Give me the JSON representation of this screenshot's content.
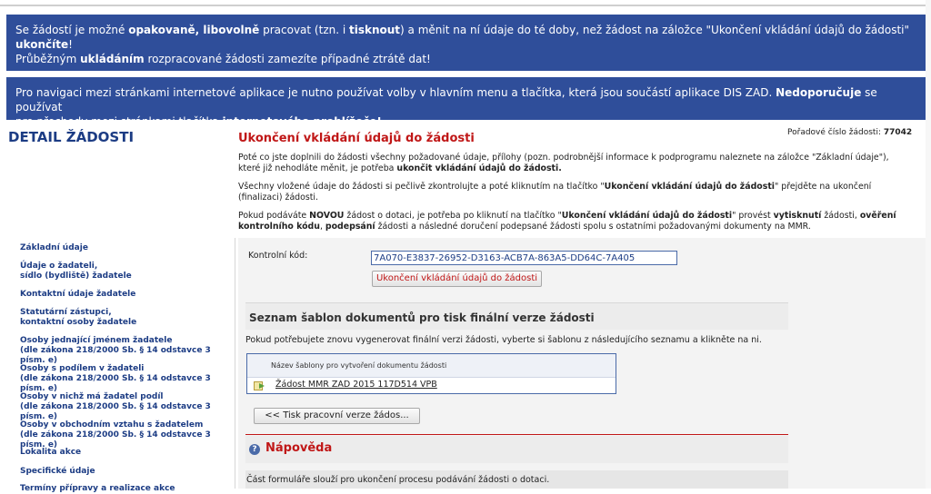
{
  "banner1": {
    "l1a": "Se žádostí je možné ",
    "l1b": "opakovaně, libovolně",
    "l1c": " pracovat (tzn. i ",
    "l1d": "tisknout",
    "l1e": ") a měnit na ní údaje do té doby, než žádost na záložce \"Ukončení vkládání údajů do žádosti\"",
    "l2": "ukončíte",
    "l2b": "!",
    "l3a": "Průběžným ",
    "l3b": "ukládáním",
    "l3c": " rozpracované žádosti zamezíte případné ztrátě dat!"
  },
  "banner2": {
    "a": "Pro navigaci mezi stránkami internetové aplikace je nutno používat volby v hlavním menu a tlačítka, která jsou součástí aplikace DIS ZAD. ",
    "b": "Nedoporučuje",
    "c": " se používat",
    "d": "pro přechody mezi stránkami tlačítka ",
    "e": "internetového prohlížeče!",
    "f": "."
  },
  "sidebar": {
    "title": "DETAIL ŽÁDOSTI",
    "items": [
      {
        "l1": "Základní údaje",
        "l2": ""
      },
      {
        "l1": "Údaje o žadateli,",
        "l2": "sídlo (bydliště) žadatele"
      },
      {
        "l1": "Kontaktní údaje žadatele",
        "l2": ""
      },
      {
        "l1": "Statutární zástupci,",
        "l2": "kontaktní osoby žadatele"
      },
      {
        "l1": "Osoby jednající jménem žadatele",
        "l2": "(dle zákona 218/2000 Sb. § 14 odstavce 3 písm. e)"
      },
      {
        "l1": "Osoby s podílem v žadateli",
        "l2": "(dle zákona 218/2000 Sb. § 14 odstavce 3 písm. e)"
      },
      {
        "l1": "Osoby v nichž má žadatel podíl",
        "l2": "(dle zákona 218/2000 Sb. § 14 odstavce 3 písm. e)"
      },
      {
        "l1": "Osoby v obchodním vztahu s žadatelem",
        "l2": "(dle zákona 218/2000 Sb. § 14 odstavce 3 písm. e)"
      },
      {
        "l1": "Lokalita akce",
        "l2": ""
      },
      {
        "l1": "Specifické údaje",
        "l2": ""
      },
      {
        "l1": "Termíny přípravy a realizace akce",
        "l2": ""
      }
    ]
  },
  "main": {
    "title": "Ukončení vkládání údajů do žádosti",
    "app_no_label": "Pořadové číslo žádosti: ",
    "app_no": "77042",
    "p1a": "Poté co jste doplnili do žádosti všechny požadované údaje, přílohy (pozn. podrobnější informace k podprogramu naleznete na záložce \"Základní údaje\"),",
    "p1b": "které již nehodláte měnit, je potřeba ",
    "p1c": "ukončit vkládání údajů do žádosti.",
    "p2a": "Všechny vložené údaje do žádosti si pečlivě zkontrolujte a poté kliknutím na tlačítko \"",
    "p2b": "Ukončení vkládání údajů do žádosti",
    "p2c": "\" přejděte na ukončení",
    "p2d": "(finalizaci) žádosti.",
    "p3a": "Pokud podáváte ",
    "p3b": "NOVOU",
    "p3c": " žádost o dotaci, je potřeba po kliknutí na tlačítko \"",
    "p3d": "Ukončení vkládání údajů do žádosti",
    "p3e": "\" provést ",
    "p3f": "vytisknutí",
    "p3g": " žádosti, ",
    "p3h": "ověření",
    "p3i": "kontrolního kódu",
    "p3j": ", ",
    "p3k": "podepsání",
    "p3l": " žádosti a následné doručení podepsané žádosti spolu s ostatními požadovanými dokumenty na MMR.",
    "control_label": "Kontrolní kód:",
    "control_code": "7A070-E3837-26952-D3163-ACB7A-863A5-DD64C-7A405",
    "finish_button": "Ukončení vkládání údajů do žádosti",
    "templates_title": "Seznam šablon dokumentů pro tisk finální verze žádosti",
    "templates_note": "Pokud potřebujete znovu vygenerovat finální verzi žádosti, vyberte si šablonu z následujícího seznamu a klikněte na ni.",
    "templates_header": "Název šablony pro vytvoření dokumentu žádosti",
    "template_item": "Žádost MMR ZAD 2015 117D514 VPB",
    "print_button": "<< Tisk pracovní verze žádos...",
    "help_title": "Nápověda",
    "help_icon": "?",
    "help_text": "Část formuláře slouží pro ukončení procesu podávání žádosti o dotaci."
  },
  "colors": {
    "banner": "#2f4e9a",
    "accent_red": "#c01717",
    "nav_blue": "#1c3c84"
  }
}
